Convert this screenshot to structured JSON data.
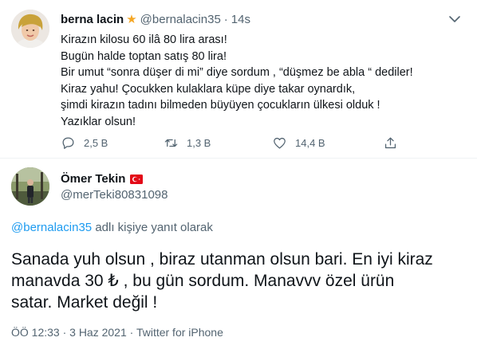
{
  "original_tweet": {
    "display_name": "berna lacin",
    "badge_icon": "star-icon",
    "handle": "@bernalacin35",
    "separator": "·",
    "time": "14s",
    "lines": [
      "Kirazın kilosu 60 ilâ 80 lira arası!",
      "Bugün halde toptan satış 80 lira!",
      "Bir umut “sonra düşer di mi” diye sordum , “düşmez be abla “ dediler!",
      "Kiraz yahu! Çocukken kulaklara küpe diye takar oynardık,",
      "şimdi kirazın tadını bilmeden büyüyen çocukların ülkesi olduk !",
      "Yazıklar olsun!"
    ],
    "actions": {
      "reply": {
        "icon": "reply-icon",
        "count": "2,5 B"
      },
      "retweet": {
        "icon": "retweet-icon",
        "count": "1,3 B"
      },
      "like": {
        "icon": "heart-icon",
        "count": "14,4 B"
      },
      "share": {
        "icon": "share-icon"
      }
    }
  },
  "reply_tweet": {
    "display_name": "Ömer Tekin",
    "flag_icon": "turkey-flag-icon",
    "handle": "@merTeki80831098",
    "replying_to_user": "@bernalacin35",
    "replying_to_text": "adlı kişiye yanıt olarak",
    "lines": [
      "Sanada yuh olsun , biraz utanman olsun bari. En iyi kiraz",
      "manavda 30 ₺ , bu gün sordum. Manavvv özel ürün",
      "satar. Market değil !"
    ],
    "meta": "ÖÖ 12:33 · 3 Haz 2021 · Twitter for iPhone"
  },
  "colors": {
    "accent": "#1d9bf0",
    "muted": "#536471",
    "text": "#0f1419",
    "star": "#f5a623",
    "flag": "#e30a17"
  }
}
